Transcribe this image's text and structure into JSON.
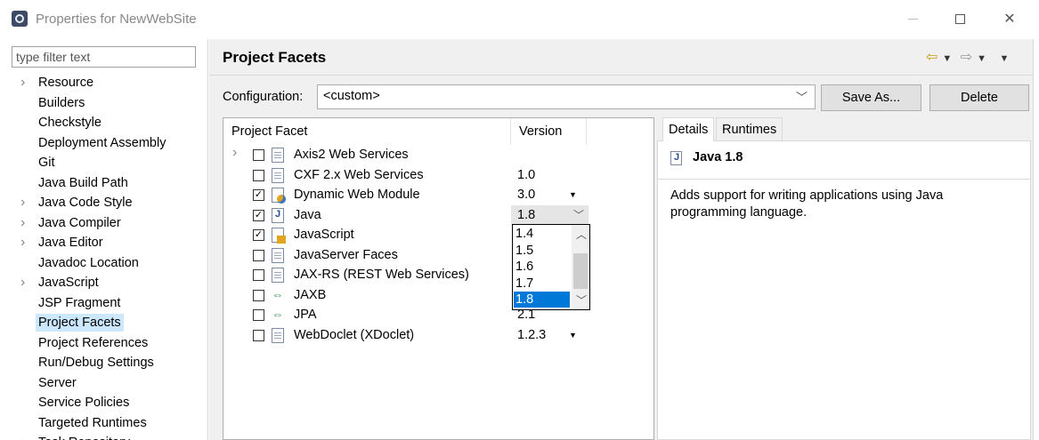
{
  "window": {
    "title": "Properties for NewWebSite"
  },
  "sidebar": {
    "filter_placeholder": "type filter text",
    "items": [
      {
        "label": "Resource",
        "expandable": true
      },
      {
        "label": "Builders",
        "expandable": false
      },
      {
        "label": "Checkstyle",
        "expandable": false
      },
      {
        "label": "Deployment Assembly",
        "expandable": false
      },
      {
        "label": "Git",
        "expandable": false
      },
      {
        "label": "Java Build Path",
        "expandable": false
      },
      {
        "label": "Java Code Style",
        "expandable": true
      },
      {
        "label": "Java Compiler",
        "expandable": true
      },
      {
        "label": "Java Editor",
        "expandable": true
      },
      {
        "label": "Javadoc Location",
        "expandable": false
      },
      {
        "label": "JavaScript",
        "expandable": true
      },
      {
        "label": "JSP Fragment",
        "expandable": false
      },
      {
        "label": "Project Facets",
        "expandable": false,
        "selected": true
      },
      {
        "label": "Project References",
        "expandable": false
      },
      {
        "label": "Run/Debug Settings",
        "expandable": false
      },
      {
        "label": "Server",
        "expandable": false
      },
      {
        "label": "Service Policies",
        "expandable": false
      },
      {
        "label": "Targeted Runtimes",
        "expandable": false
      },
      {
        "label": "Task Repository",
        "expandable": true
      }
    ]
  },
  "main": {
    "title": "Project Facets",
    "configuration_label": "Configuration:",
    "configuration_value": "<custom>",
    "save_as_label": "Save As...",
    "delete_label": "Delete"
  },
  "facets": {
    "col_facet": "Project Facet",
    "col_version": "Version",
    "rows": [
      {
        "name": "Axis2 Web Services",
        "version": "",
        "checked": false,
        "icon": "document-icon",
        "expandable": true,
        "has_dropdown": false
      },
      {
        "name": "CXF 2.x Web Services",
        "version": "1.0",
        "checked": false,
        "icon": "document-icon",
        "expandable": false,
        "has_dropdown": false
      },
      {
        "name": "Dynamic Web Module",
        "version": "3.0",
        "checked": true,
        "icon": "web-module-icon",
        "expandable": false,
        "has_dropdown": true
      },
      {
        "name": "Java",
        "version": "1.8",
        "checked": true,
        "icon": "java-icon",
        "expandable": false,
        "has_dropdown": true,
        "active": true
      },
      {
        "name": "JavaScript",
        "version": "",
        "checked": true,
        "icon": "javascript-icon",
        "expandable": false,
        "has_dropdown": false
      },
      {
        "name": "JavaServer Faces",
        "version": "",
        "checked": false,
        "icon": "document-icon",
        "expandable": false,
        "has_dropdown": false
      },
      {
        "name": "JAX-RS (REST Web Services)",
        "version": "",
        "checked": false,
        "icon": "document-icon",
        "expandable": false,
        "has_dropdown": false
      },
      {
        "name": "JAXB",
        "version": "",
        "checked": false,
        "icon": "plug-icon",
        "expandable": false,
        "has_dropdown": false
      },
      {
        "name": "JPA",
        "version": "2.1",
        "checked": false,
        "icon": "plug-icon",
        "expandable": false,
        "has_dropdown": false
      },
      {
        "name": "WebDoclet (XDoclet)",
        "version": "1.2.3",
        "checked": false,
        "icon": "document-icon",
        "expandable": false,
        "has_dropdown": true
      }
    ],
    "version_options": [
      "1.4",
      "1.5",
      "1.6",
      "1.7",
      "1.8"
    ],
    "version_selected": "1.8"
  },
  "details": {
    "tab_details": "Details",
    "tab_runtimes": "Runtimes",
    "heading": "Java 1.8",
    "description": "Adds support for writing applications using Java programming language."
  }
}
